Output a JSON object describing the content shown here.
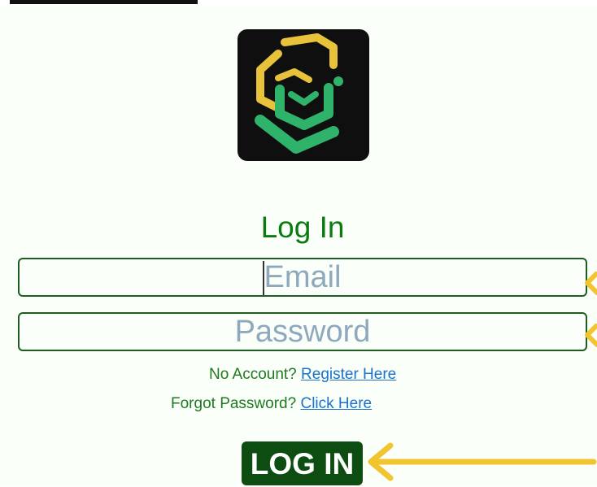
{
  "login": {
    "title": "Log In",
    "email": {
      "placeholder": "Email",
      "value": ""
    },
    "password": {
      "placeholder": "Password",
      "value": ""
    },
    "register_prompt": "No Account?",
    "register_link": "Register Here",
    "forgot_prompt": "Forgot Password?",
    "forgot_link": "Click Here",
    "submit_label": "LOG IN"
  },
  "colors": {
    "brand_green": "#0b7a10",
    "button_green": "#0d4d12",
    "link_blue": "#1a73c9",
    "annotation_yellow": "#f2c530",
    "logo_gold": "#e8c23a",
    "logo_green": "#2fb36a"
  },
  "icons": {
    "logo": "app-logo-icon",
    "annotation": "yellow-arrow-icon"
  }
}
